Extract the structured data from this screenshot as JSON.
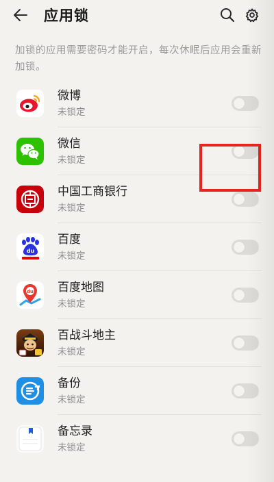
{
  "header": {
    "title": "应用锁",
    "back_icon": "back-arrow-icon",
    "search_icon": "search-icon",
    "settings_icon": "gear-icon"
  },
  "description": "加锁的应用需要密码才能开启，每次休眠后应用会重新加锁。",
  "apps": [
    {
      "name": "微博",
      "status": "未锁定",
      "icon": "weibo-icon",
      "locked": false
    },
    {
      "name": "微信",
      "status": "未锁定",
      "icon": "wechat-icon",
      "locked": false
    },
    {
      "name": "中国工商银行",
      "status": "未锁定",
      "icon": "icbc-icon",
      "locked": false
    },
    {
      "name": "百度",
      "status": "未锁定",
      "icon": "baidu-icon",
      "locked": false
    },
    {
      "name": "百度地图",
      "status": "未锁定",
      "icon": "baidu-map-icon",
      "locked": false
    },
    {
      "name": "百战斗地主",
      "status": "未锁定",
      "icon": "landlord-game-icon",
      "locked": false
    },
    {
      "name": "备份",
      "status": "未锁定",
      "icon": "backup-icon",
      "locked": false
    },
    {
      "name": "备忘录",
      "status": "未锁定",
      "icon": "memo-icon",
      "locked": false
    }
  ],
  "colors": {
    "background": "#f3f2ef",
    "switch_off": "#dcdbd8",
    "highlight": "#e8241d",
    "secondary_text": "#8e8e8e"
  }
}
